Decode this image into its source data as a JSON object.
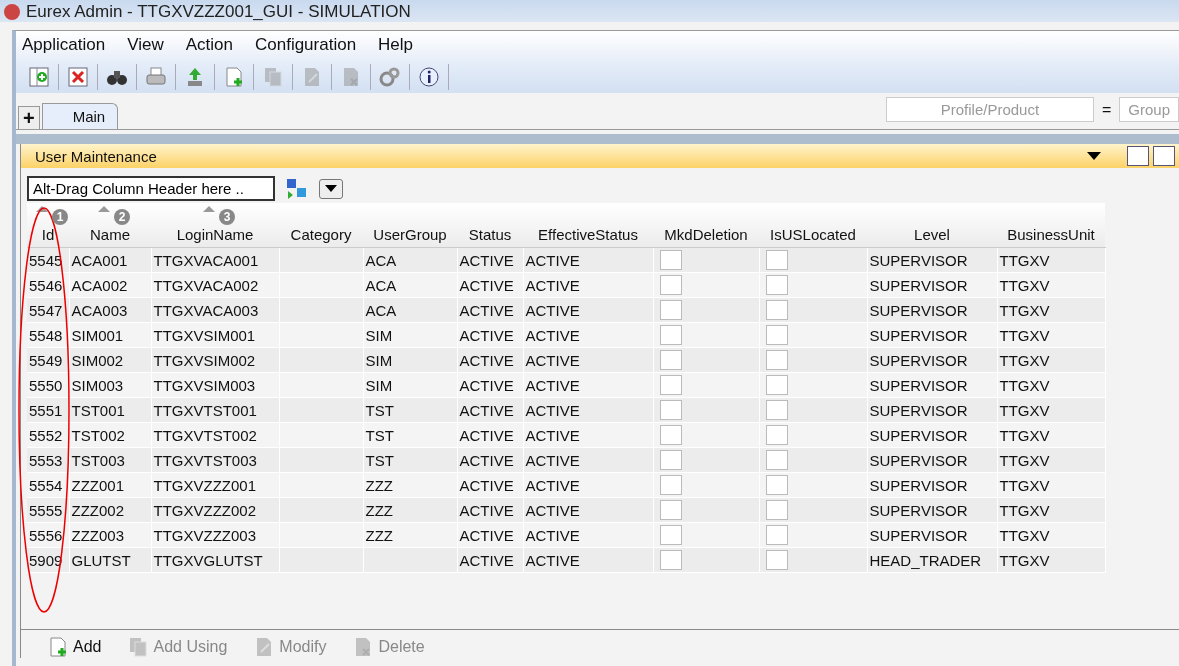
{
  "window": {
    "title": "Eurex Admin - TTGXVZZZ001_GUI - SIMULATION"
  },
  "menu": [
    "Application",
    "View",
    "Action",
    "Configuration",
    "Help"
  ],
  "toolbar": [
    {
      "kind": "new",
      "disabled": false
    },
    {
      "kind": "close",
      "disabled": false
    },
    {
      "kind": "find",
      "disabled": false
    },
    {
      "kind": "print",
      "disabled": false
    },
    {
      "kind": "export",
      "disabled": false
    },
    {
      "kind": "add",
      "disabled": false
    },
    {
      "kind": "copy",
      "disabled": true
    },
    {
      "kind": "edit",
      "disabled": true
    },
    {
      "kind": "delete",
      "disabled": true
    },
    {
      "kind": "settings",
      "disabled": false
    },
    {
      "kind": "info",
      "disabled": false
    }
  ],
  "tabs": [
    {
      "label": "+",
      "selected": false
    },
    {
      "label": "Main",
      "selected": true
    }
  ],
  "filter": {
    "placeholder": "Profile/Product",
    "operator": "=",
    "group_placeholder": "Group"
  },
  "panel": {
    "title": "User Maintenance",
    "group_field": {
      "value": "Alt-Drag Column Header here .."
    }
  },
  "table": {
    "columns": [
      {
        "label": "Id",
        "sort_order": "1",
        "kind": "text"
      },
      {
        "label": "Name",
        "sort_order": "2",
        "kind": "text"
      },
      {
        "label": "LoginName",
        "sort_order": "3",
        "kind": "text"
      },
      {
        "label": "Category",
        "kind": "text"
      },
      {
        "label": "UserGroup",
        "kind": "text"
      },
      {
        "label": "Status",
        "kind": "text"
      },
      {
        "label": "EffectiveStatus",
        "kind": "text"
      },
      {
        "label": "MkdDeletion",
        "kind": "check"
      },
      {
        "label": "IsUSLocated",
        "kind": "check"
      },
      {
        "label": "Level",
        "kind": "text"
      },
      {
        "label": "BusinessUnit",
        "kind": "text"
      }
    ],
    "rows": [
      {
        "cells": [
          "5545",
          "ACA001",
          "TTGXVACA001",
          "",
          "ACA",
          "ACTIVE",
          "ACTIVE",
          false,
          false,
          "SUPERVISOR",
          "TTGXV"
        ]
      },
      {
        "cells": [
          "5546",
          "ACA002",
          "TTGXVACA002",
          "",
          "ACA",
          "ACTIVE",
          "ACTIVE",
          false,
          false,
          "SUPERVISOR",
          "TTGXV"
        ]
      },
      {
        "cells": [
          "5547",
          "ACA003",
          "TTGXVACA003",
          "",
          "ACA",
          "ACTIVE",
          "ACTIVE",
          false,
          false,
          "SUPERVISOR",
          "TTGXV"
        ]
      },
      {
        "cells": [
          "5548",
          "SIM001",
          "TTGXVSIM001",
          "",
          "SIM",
          "ACTIVE",
          "ACTIVE",
          false,
          false,
          "SUPERVISOR",
          "TTGXV"
        ]
      },
      {
        "cells": [
          "5549",
          "SIM002",
          "TTGXVSIM002",
          "",
          "SIM",
          "ACTIVE",
          "ACTIVE",
          false,
          false,
          "SUPERVISOR",
          "TTGXV"
        ]
      },
      {
        "cells": [
          "5550",
          "SIM003",
          "TTGXVSIM003",
          "",
          "SIM",
          "ACTIVE",
          "ACTIVE",
          false,
          false,
          "SUPERVISOR",
          "TTGXV"
        ]
      },
      {
        "cells": [
          "5551",
          "TST001",
          "TTGXVTST001",
          "",
          "TST",
          "ACTIVE",
          "ACTIVE",
          false,
          false,
          "SUPERVISOR",
          "TTGXV"
        ]
      },
      {
        "cells": [
          "5552",
          "TST002",
          "TTGXVTST002",
          "",
          "TST",
          "ACTIVE",
          "ACTIVE",
          false,
          false,
          "SUPERVISOR",
          "TTGXV"
        ]
      },
      {
        "cells": [
          "5553",
          "TST003",
          "TTGXVTST003",
          "",
          "TST",
          "ACTIVE",
          "ACTIVE",
          false,
          false,
          "SUPERVISOR",
          "TTGXV"
        ]
      },
      {
        "cells": [
          "5554",
          "ZZZ001",
          "TTGXVZZZ001",
          "",
          "ZZZ",
          "ACTIVE",
          "ACTIVE",
          false,
          false,
          "SUPERVISOR",
          "TTGXV"
        ]
      },
      {
        "cells": [
          "5555",
          "ZZZ002",
          "TTGXVZZZ002",
          "",
          "ZZZ",
          "ACTIVE",
          "ACTIVE",
          false,
          false,
          "SUPERVISOR",
          "TTGXV"
        ]
      },
      {
        "cells": [
          "5556",
          "ZZZ003",
          "TTGXVZZZ003",
          "",
          "ZZZ",
          "ACTIVE",
          "ACTIVE",
          false,
          false,
          "SUPERVISOR",
          "TTGXV"
        ]
      },
      {
        "cells": [
          "5909",
          "GLUTST",
          "TTGXVGLUTST",
          "",
          "",
          "ACTIVE",
          "ACTIVE",
          false,
          false,
          "HEAD_TRADER",
          "TTGXV"
        ]
      }
    ]
  },
  "actions": [
    {
      "label": "Add",
      "kind": "add",
      "disabled": false
    },
    {
      "label": "Add Using",
      "kind": "copy",
      "disabled": true
    },
    {
      "label": "Modify",
      "kind": "edit",
      "disabled": true
    },
    {
      "label": "Delete",
      "kind": "delete",
      "disabled": true
    }
  ]
}
